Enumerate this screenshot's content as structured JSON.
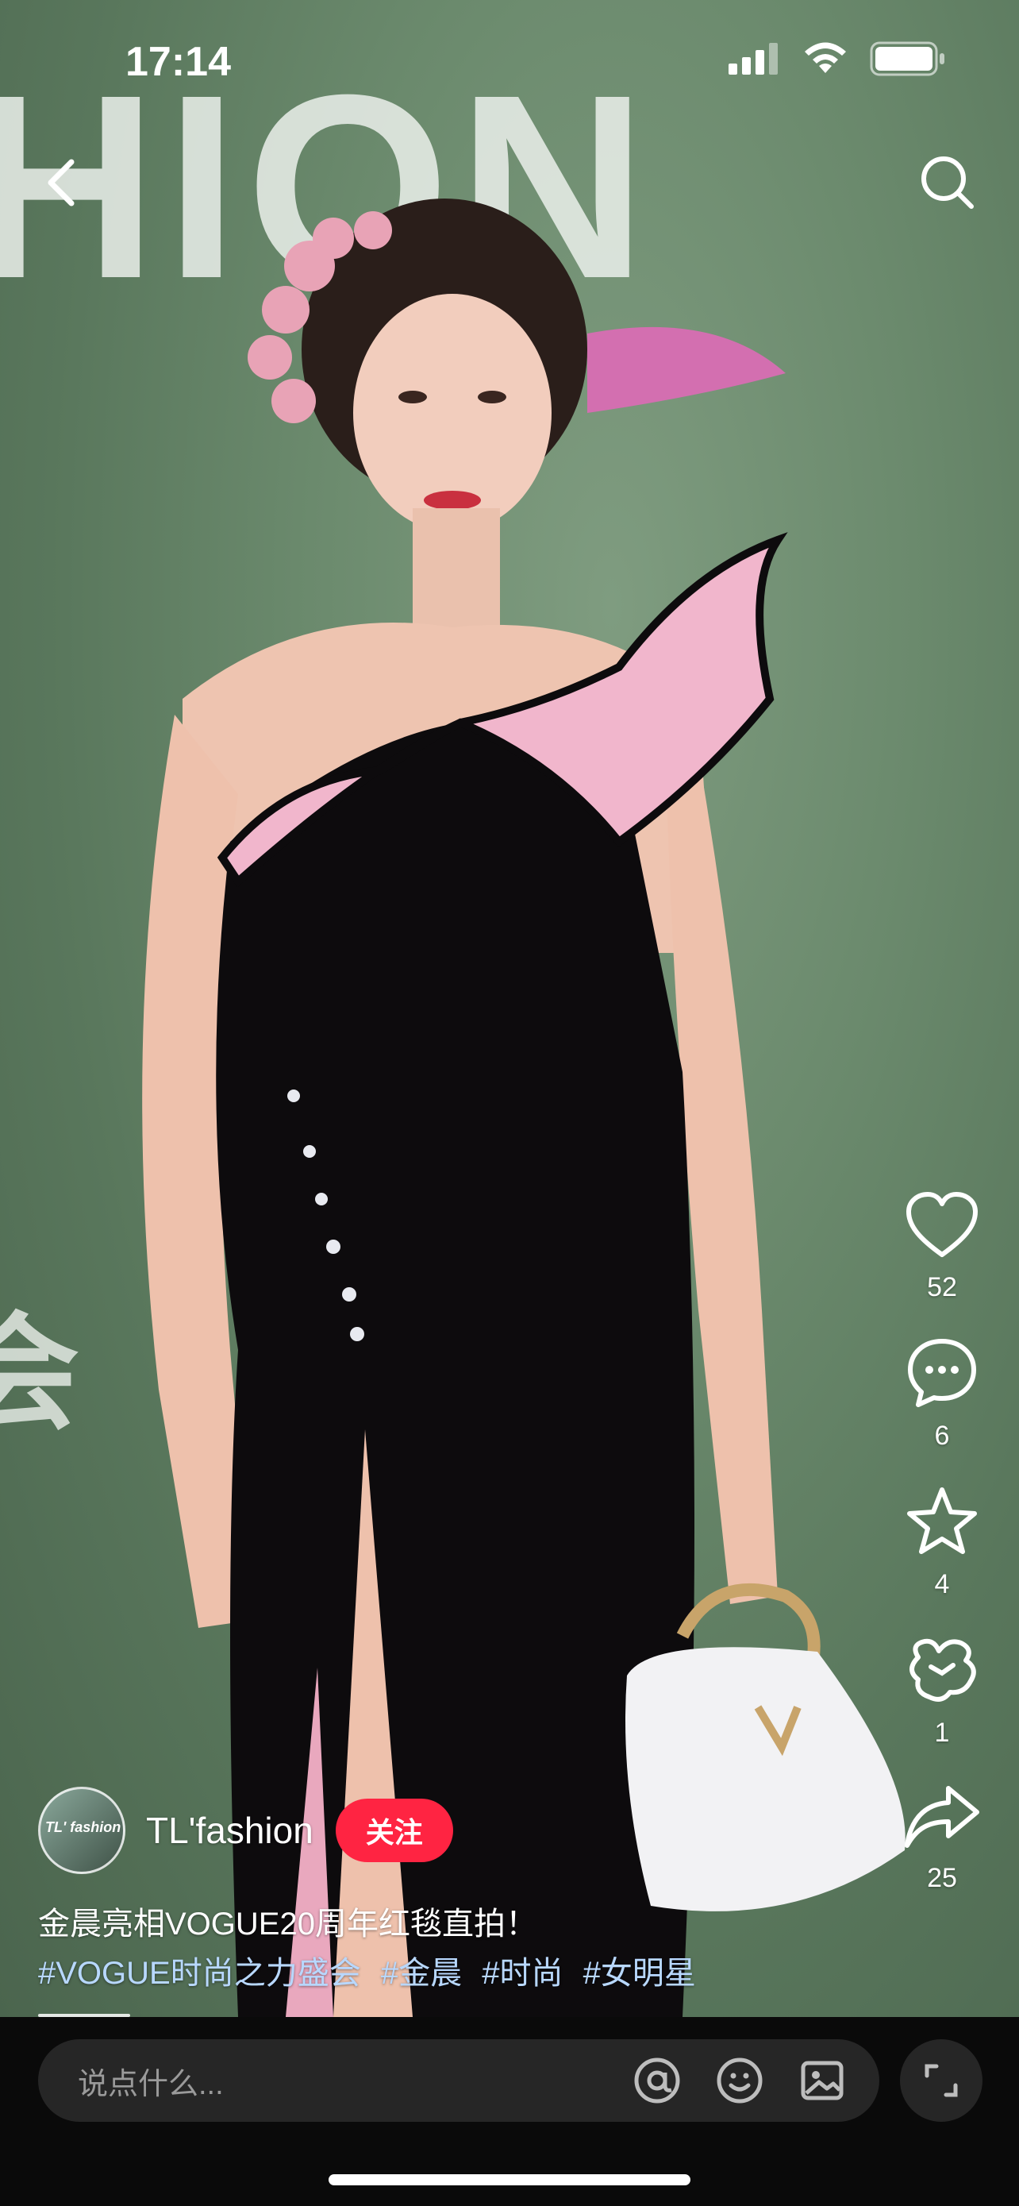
{
  "status_bar": {
    "time": "17:14"
  },
  "backdrop": {
    "letters": "HION",
    "side_glyph": "会"
  },
  "actions": [
    {
      "name": "like",
      "icon": "heart-icon",
      "count": "52"
    },
    {
      "name": "comment",
      "icon": "comment-icon",
      "count": "6"
    },
    {
      "name": "collect",
      "icon": "star-icon",
      "count": "4"
    },
    {
      "name": "gift",
      "icon": "gift-icon",
      "count": "1"
    },
    {
      "name": "share",
      "icon": "share-icon",
      "count": "25"
    }
  ],
  "author": {
    "name": "TL'fashion",
    "avatar_text": "TL' fashion",
    "follow_label": "关注"
  },
  "caption": "金晨亮相VOGUE20周年红毯直拍！",
  "tags": [
    "#VOGUE时尚之力盛会",
    "#金晨",
    "#时尚",
    "#女明星"
  ],
  "comment": {
    "placeholder": "说点什么..."
  },
  "colors": {
    "follow": "#ff2442",
    "tag": "#b8d8ff",
    "bottom_bar": "#0a0a0a"
  }
}
